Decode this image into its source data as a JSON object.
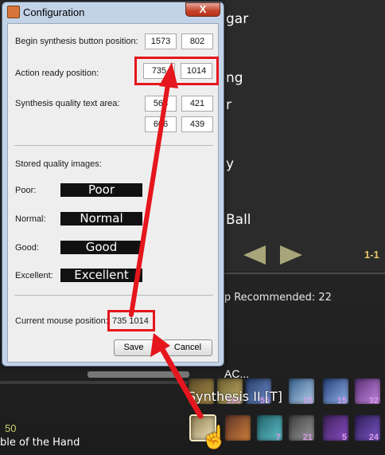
{
  "window": {
    "title": "Configuration",
    "close_label": "X"
  },
  "fields": {
    "begin_label": "Begin synthesis button position:",
    "begin_x": "1573",
    "begin_y": "802",
    "action_label": "Action ready position:",
    "action_x": "735",
    "action_y": "1014",
    "quality_label": "Synthesis quality text area:",
    "quality_x1": "563",
    "quality_y1": "421",
    "quality_x2": "666",
    "quality_y2": "439"
  },
  "stored": {
    "heading": "Stored quality images:",
    "items": [
      {
        "label": "Poor:",
        "image_text": "Poor"
      },
      {
        "label": "Normal:",
        "image_text": "Normal"
      },
      {
        "label": "Good:",
        "image_text": "Good"
      },
      {
        "label": "Excellent:",
        "image_text": "Excellent"
      }
    ]
  },
  "mouse": {
    "label": "Current mouse position:",
    "value": "735 1014"
  },
  "buttons": {
    "save": "Save",
    "cancel": "Cancel"
  },
  "game": {
    "list_items": [
      "gar",
      "ng",
      "r",
      "y",
      "Ball"
    ],
    "pager": "1-1",
    "recommend_text": "hip Recommended: 22",
    "hotbar_label": "AC...",
    "synthesis_title": "Synthesis II [T]",
    "level_number": "50",
    "hand_text": "ble of the Hand",
    "top_counts": [
      "160",
      "55",
      "15",
      "15",
      "32"
    ],
    "bottom_counts": [
      "",
      "7",
      "21",
      "5",
      "24"
    ]
  },
  "colors": {
    "highlight": "#e5161d",
    "dialog_frame": "#c2d3e7",
    "close_button": "#c7432b"
  }
}
